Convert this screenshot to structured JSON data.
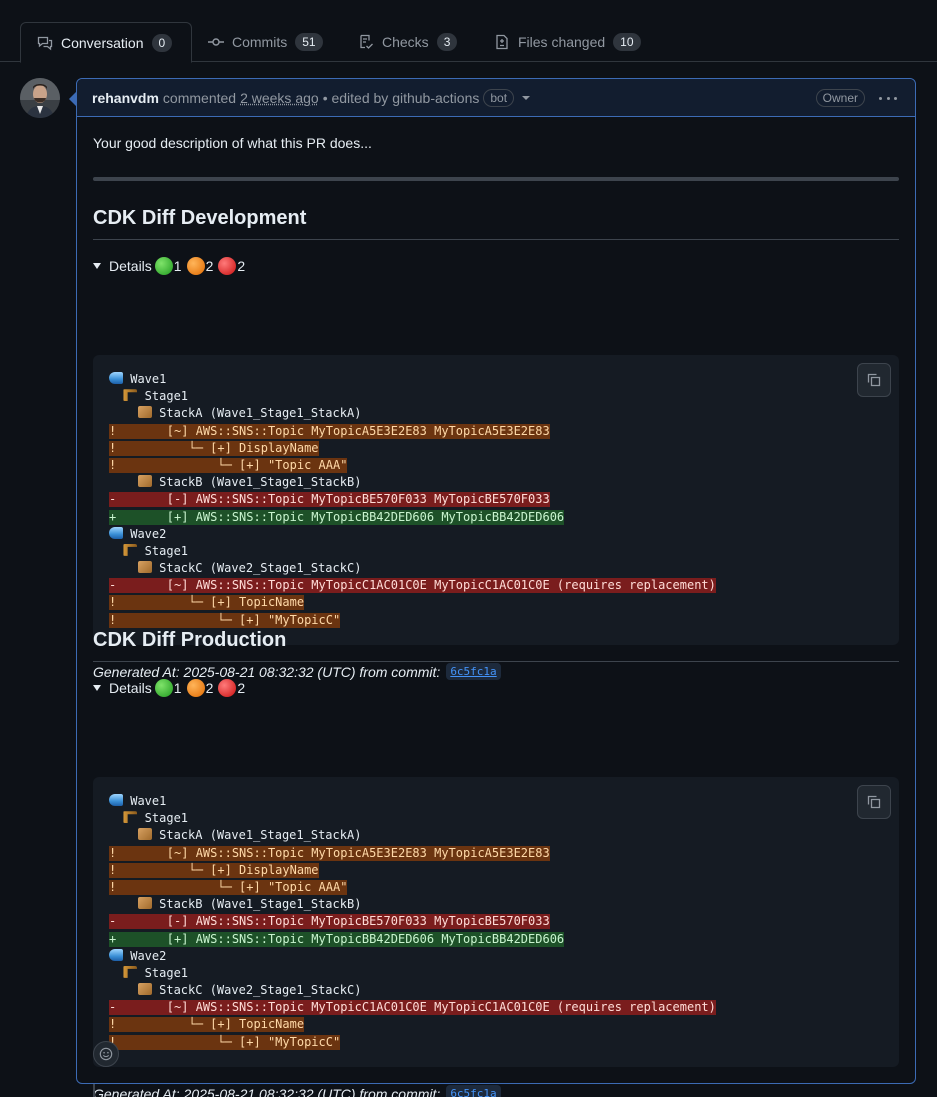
{
  "tabs": [
    {
      "label": "Conversation",
      "count": "0",
      "icon": "comment-discussion-icon"
    },
    {
      "label": "Commits",
      "count": "51",
      "icon": "git-commit-icon"
    },
    {
      "label": "Checks",
      "count": "3",
      "icon": "checklist-icon"
    },
    {
      "label": "Files changed",
      "count": "10",
      "icon": "file-diff-icon"
    }
  ],
  "comment": {
    "author": "rehanvdm",
    "action": "commented",
    "time": "2 weeks ago",
    "edited": "• edited by github-actions",
    "bot_badge": "bot",
    "owner_badge": "Owner",
    "description": "Your good description of what this PR does..."
  },
  "sections": [
    {
      "title": "CDK Diff Development",
      "details_label": "Details",
      "counts": {
        "green": "1",
        "orange": "2",
        "red": "2"
      },
      "generated_prefix": "Generated At: 2025-08-21 08:32:32 (UTC) from commit:",
      "commit": "6c5fc1a"
    },
    {
      "title": "CDK Diff Production",
      "details_label": "Details",
      "counts": {
        "green": "1",
        "orange": "2",
        "red": "2"
      },
      "generated_prefix": "Generated At: 2025-08-21 08:32:32 (UTC) from commit:",
      "commit": "6c5fc1a"
    }
  ],
  "diff_lines": [
    {
      "kind": "plain",
      "icon": "wave",
      "indent": "",
      "text": " Wave1"
    },
    {
      "kind": "plain",
      "icon": "crane",
      "indent": "  ",
      "text": " Stage1"
    },
    {
      "kind": "plain",
      "icon": "box",
      "indent": "    ",
      "text": " StackA (Wave1_Stage1_StackA)"
    },
    {
      "kind": "warn",
      "icon": "",
      "indent": "",
      "text": "!       [~] AWS::SNS::Topic MyTopicA5E3E2E83 MyTopicA5E3E2E83"
    },
    {
      "kind": "warn",
      "icon": "",
      "indent": "",
      "text": "!          └─ [+] DisplayName"
    },
    {
      "kind": "warn",
      "icon": "",
      "indent": "",
      "text": "!              └─ [+] \"Topic AAA\""
    },
    {
      "kind": "plain",
      "icon": "box",
      "indent": "    ",
      "text": " StackB (Wave1_Stage1_StackB)"
    },
    {
      "kind": "del",
      "icon": "",
      "indent": "",
      "text": "-       [-] AWS::SNS::Topic MyTopicBE570F033 MyTopicBE570F033"
    },
    {
      "kind": "add",
      "icon": "",
      "indent": "",
      "text": "+       [+] AWS::SNS::Topic MyTopicBB42DED606 MyTopicBB42DED606"
    },
    {
      "kind": "plain",
      "icon": "wave",
      "indent": "",
      "text": " Wave2"
    },
    {
      "kind": "plain",
      "icon": "crane",
      "indent": "  ",
      "text": " Stage1"
    },
    {
      "kind": "plain",
      "icon": "box",
      "indent": "    ",
      "text": " StackC (Wave2_Stage1_StackC)"
    },
    {
      "kind": "del",
      "icon": "",
      "indent": "",
      "text": "-       [~] AWS::SNS::Topic MyTopicC1AC01C0E MyTopicC1AC01C0E (requires replacement)"
    },
    {
      "kind": "warn",
      "icon": "",
      "indent": "",
      "text": "!          └─ [+] TopicName"
    },
    {
      "kind": "warn",
      "icon": "",
      "indent": "",
      "text": "!              └─ [+] \"MyTopicC\""
    }
  ]
}
